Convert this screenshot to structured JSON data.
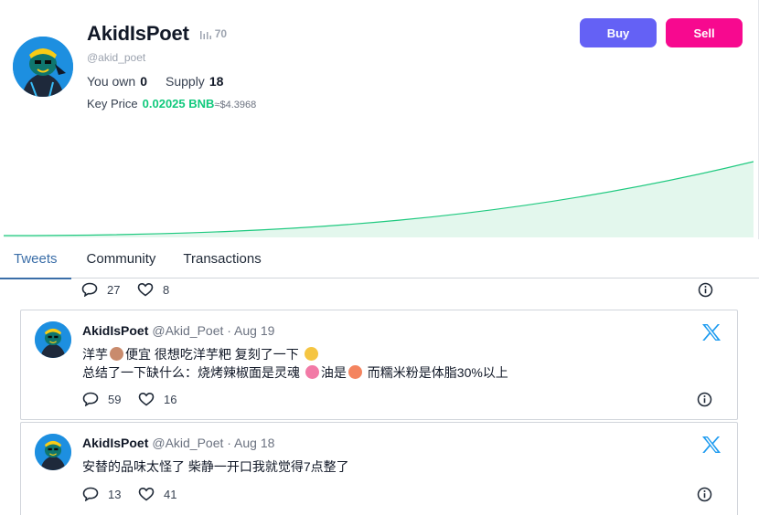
{
  "profile": {
    "name": "AkidIsPoet",
    "rank": "70",
    "handle": "@akid_poet",
    "you_own_label": "You own",
    "you_own_value": "0",
    "supply_label": "Supply",
    "supply_value": "18",
    "key_price_label": "Key Price",
    "key_price_bnb": "0.02025 BNB",
    "key_price_usd": "≈$4.3968"
  },
  "actions": {
    "buy": "Buy",
    "sell": "Sell"
  },
  "colors": {
    "buy": "#6461f5",
    "sell": "#f7098f",
    "price": "#10c97c",
    "chart_line": "#1ec97f",
    "chart_fill": "#e3f7ed",
    "tab_active": "#3b6ea8",
    "x_blue": "#1d9bf0"
  },
  "tabs": [
    "Tweets",
    "Community",
    "Transactions"
  ],
  "previous_tweet": {
    "replies": "27",
    "likes": "8"
  },
  "tweets": [
    {
      "name": "AkidIsPoet",
      "meta": "@Akid_Poet · Aug 19",
      "line1_a": "洋芋",
      "line1_b": "便宜 很想吃洋芋粑 复刻了一下",
      "line2_a": "总结了一下缺什么：烧烤辣椒面是灵魂",
      "line2_b": "油是",
      "line2_c": " 而糯米粉是体脂30%以上",
      "replies": "59",
      "likes": "16"
    },
    {
      "name": "AkidIsPoet",
      "meta": "@Akid_Poet · Aug 18",
      "line1": "安替的品味太怪了 柴静一开口我就觉得7点整了",
      "replies": "13",
      "likes": "41"
    }
  ],
  "icons": [
    "bar-chart-icon",
    "reply-icon",
    "heart-icon",
    "info-icon",
    "x-logo-icon"
  ]
}
